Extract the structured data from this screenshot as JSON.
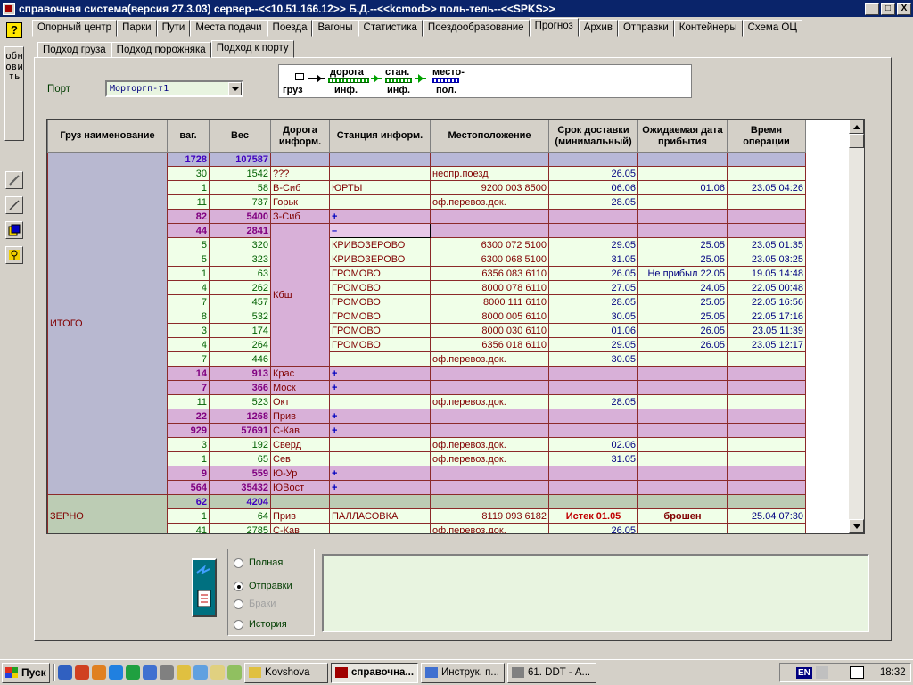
{
  "window": {
    "title": "справочная система(версия 27.3.03) сервер--<<10.51.166.12>> Б.Д.--<<kcmod>> поль-тель--<<SPKS>>",
    "min": "_",
    "max": "□",
    "close": "X"
  },
  "leftbar": {
    "help": "?",
    "refresh": "обновить"
  },
  "tabs": [
    "Опорный центр",
    "Парки",
    "Пути",
    "Места подачи",
    "Поезда",
    "Вагоны",
    "Статистика",
    "Поездообразование",
    "Прогноз",
    "Архив",
    "Отправки",
    "Контейнеры",
    "Схема ОЦ"
  ],
  "active_tab": "Прогноз",
  "subtabs": [
    "Подход груза",
    "Подход порожняка",
    "Подход к порту"
  ],
  "active_subtab": "Подход к порту",
  "port": {
    "label": "Порт",
    "value": "Морторгп-т1"
  },
  "legend": {
    "cargo": "груз",
    "road": "дорога",
    "road_sub": "инф.",
    "station": "стан.",
    "station_sub": "инф.",
    "place": "место-",
    "place_sub": "пол."
  },
  "columns": [
    "Груз наименование",
    "ваг.",
    "Вес",
    "Дорога информ.",
    "Станция информ.",
    "Местоположение",
    "Срок доставки (минимальный)",
    "Ожидаемая дата прибытия",
    "Время операции"
  ],
  "groups": {
    "total": "ИТОГО",
    "grain": "ЗЕРНО"
  },
  "kbsh_road": "Кбш",
  "rows": [
    {
      "wag": "1728",
      "ves": "107587",
      "road": "",
      "st": "",
      "loc": "",
      "srok": "",
      "ozh": "",
      "vr": "",
      "kind": "sum"
    },
    {
      "wag": "30",
      "ves": "1542",
      "road": "???",
      "st": "",
      "loc": "неопр.поезд",
      "srok": "26.05",
      "ozh": "",
      "vr": "",
      "kind": "plain"
    },
    {
      "wag": "1",
      "ves": "58",
      "road": "В-Сиб",
      "st": "ЮРТЫ",
      "loc": "9200 003 8500",
      "srok": "06.06",
      "ozh": "01.06",
      "vr": "23.05 04:26",
      "kind": "plain"
    },
    {
      "wag": "11",
      "ves": "737",
      "road": "Горьк",
      "st": "",
      "loc": "оф.перевоз.док.",
      "srok": "28.05",
      "ozh": "",
      "vr": "",
      "kind": "plain"
    },
    {
      "wag": "82",
      "ves": "5400",
      "road": "З-Сиб",
      "st": "+",
      "loc": "",
      "srok": "",
      "ozh": "",
      "vr": "",
      "kind": "sub"
    },
    {
      "wag": "44",
      "ves": "2841",
      "road": "",
      "st": "–",
      "loc": "",
      "srok": "",
      "ozh": "",
      "vr": "",
      "kind": "subk"
    },
    {
      "wag": "5",
      "ves": "320",
      "road": "",
      "st": "КРИВОЗЕРОВО",
      "loc": "6300 072 5100",
      "srok": "29.05",
      "ozh": "25.05",
      "vr": "23.05 01:35",
      "kind": "plain"
    },
    {
      "wag": "5",
      "ves": "323",
      "road": "",
      "st": "КРИВОЗЕРОВО",
      "loc": "6300 068 5100",
      "srok": "31.05",
      "ozh": "25.05",
      "vr": "23.05 03:25",
      "kind": "plain"
    },
    {
      "wag": "1",
      "ves": "63",
      "road": "",
      "st": "ГРОМОВО",
      "loc": "6356 083 6110",
      "srok": "26.05",
      "ozh": "Не прибыл  22.05",
      "vr": "19.05 14:48",
      "kind": "plain"
    },
    {
      "wag": "4",
      "ves": "262",
      "road": "",
      "st": "ГРОМОВО",
      "loc": "8000 078 6110",
      "srok": "27.05",
      "ozh": "24.05",
      "vr": "22.05 00:48",
      "kind": "plain"
    },
    {
      "wag": "7",
      "ves": "457",
      "road": "",
      "st": "ГРОМОВО",
      "loc": "8000 111 6110",
      "srok": "28.05",
      "ozh": "25.05",
      "vr": "22.05 16:56",
      "kind": "plain"
    },
    {
      "wag": "8",
      "ves": "532",
      "road": "",
      "st": "ГРОМОВО",
      "loc": "8000 005 6110",
      "srok": "30.05",
      "ozh": "25.05",
      "vr": "22.05 17:16",
      "kind": "plain"
    },
    {
      "wag": "3",
      "ves": "174",
      "road": "",
      "st": "ГРОМОВО",
      "loc": "8000 030 6110",
      "srok": "01.06",
      "ozh": "26.05",
      "vr": "23.05 11:39",
      "kind": "plain"
    },
    {
      "wag": "4",
      "ves": "264",
      "road": "",
      "st": "ГРОМОВО",
      "loc": "6356 018 6110",
      "srok": "29.05",
      "ozh": "26.05",
      "vr": "23.05 12:17",
      "kind": "plain"
    },
    {
      "wag": "7",
      "ves": "446",
      "road": "",
      "st": "",
      "loc": "оф.перевоз.док.",
      "srok": "30.05",
      "ozh": "",
      "vr": "",
      "kind": "plain"
    },
    {
      "wag": "14",
      "ves": "913",
      "road": "Крас",
      "st": "+",
      "loc": "",
      "srok": "",
      "ozh": "",
      "vr": "",
      "kind": "sub"
    },
    {
      "wag": "7",
      "ves": "366",
      "road": "Моск",
      "st": "+",
      "loc": "",
      "srok": "",
      "ozh": "",
      "vr": "",
      "kind": "sub"
    },
    {
      "wag": "11",
      "ves": "523",
      "road": "Окт",
      "st": "",
      "loc": "оф.перевоз.док.",
      "srok": "28.05",
      "ozh": "",
      "vr": "",
      "kind": "plain"
    },
    {
      "wag": "22",
      "ves": "1268",
      "road": "Прив",
      "st": "+",
      "loc": "",
      "srok": "",
      "ozh": "",
      "vr": "",
      "kind": "sub"
    },
    {
      "wag": "929",
      "ves": "57691",
      "road": "С-Кав",
      "st": "+",
      "loc": "",
      "srok": "",
      "ozh": "",
      "vr": "",
      "kind": "sub"
    },
    {
      "wag": "3",
      "ves": "192",
      "road": "Сверд",
      "st": "",
      "loc": "оф.перевоз.док.",
      "srok": "02.06",
      "ozh": "",
      "vr": "",
      "kind": "plain"
    },
    {
      "wag": "1",
      "ves": "65",
      "road": "Сев",
      "st": "",
      "loc": "оф.перевоз.док.",
      "srok": "31.05",
      "ozh": "",
      "vr": "",
      "kind": "plain"
    },
    {
      "wag": "9",
      "ves": "559",
      "road": "Ю-Ур",
      "st": "+",
      "loc": "",
      "srok": "",
      "ozh": "",
      "vr": "",
      "kind": "sub"
    },
    {
      "wag": "564",
      "ves": "35432",
      "road": "ЮВост",
      "st": "+",
      "loc": "",
      "srok": "",
      "ozh": "",
      "vr": "",
      "kind": "sub"
    },
    {
      "wag": "62",
      "ves": "4204",
      "road": "",
      "st": "",
      "loc": "",
      "srok": "",
      "ozh": "",
      "vr": "",
      "kind": "sum2"
    },
    {
      "wag": "1",
      "ves": "64",
      "road": "Прив",
      "st": "ПАЛЛАСОВКА",
      "loc": "8119 093 6182",
      "srok": "Истек 01.05",
      "ozh": "брошен",
      "vr": "25.04 07:30",
      "kind": "plain"
    },
    {
      "wag": "41",
      "ves": "2785",
      "road": "С-Кав",
      "st": "",
      "loc": "оф.перевоз.док.",
      "srok": "26.05",
      "ozh": "",
      "vr": "",
      "kind": "plain"
    }
  ],
  "modes": [
    {
      "label": "Полная",
      "checked": false,
      "enabled": true
    },
    {
      "label": "Отправки",
      "checked": true,
      "enabled": true
    },
    {
      "label": "Браки",
      "checked": false,
      "enabled": false
    },
    {
      "label": "История",
      "checked": false,
      "enabled": true
    }
  ],
  "taskbar": {
    "start": "Пуск",
    "tasks": [
      "Kovshova",
      "справочна...",
      "Инструк. п...",
      "61. DDT - А..."
    ],
    "active_task": 1,
    "lang": "EN",
    "time": "18:32"
  },
  "colors": {
    "sum": "#b8b8d8",
    "sub": "#d8b0d8",
    "plain": "#f0ffe8",
    "sum2": "#bcccb4",
    "group_total": "#b8b8d0",
    "group_grain": "#bcccb4"
  }
}
